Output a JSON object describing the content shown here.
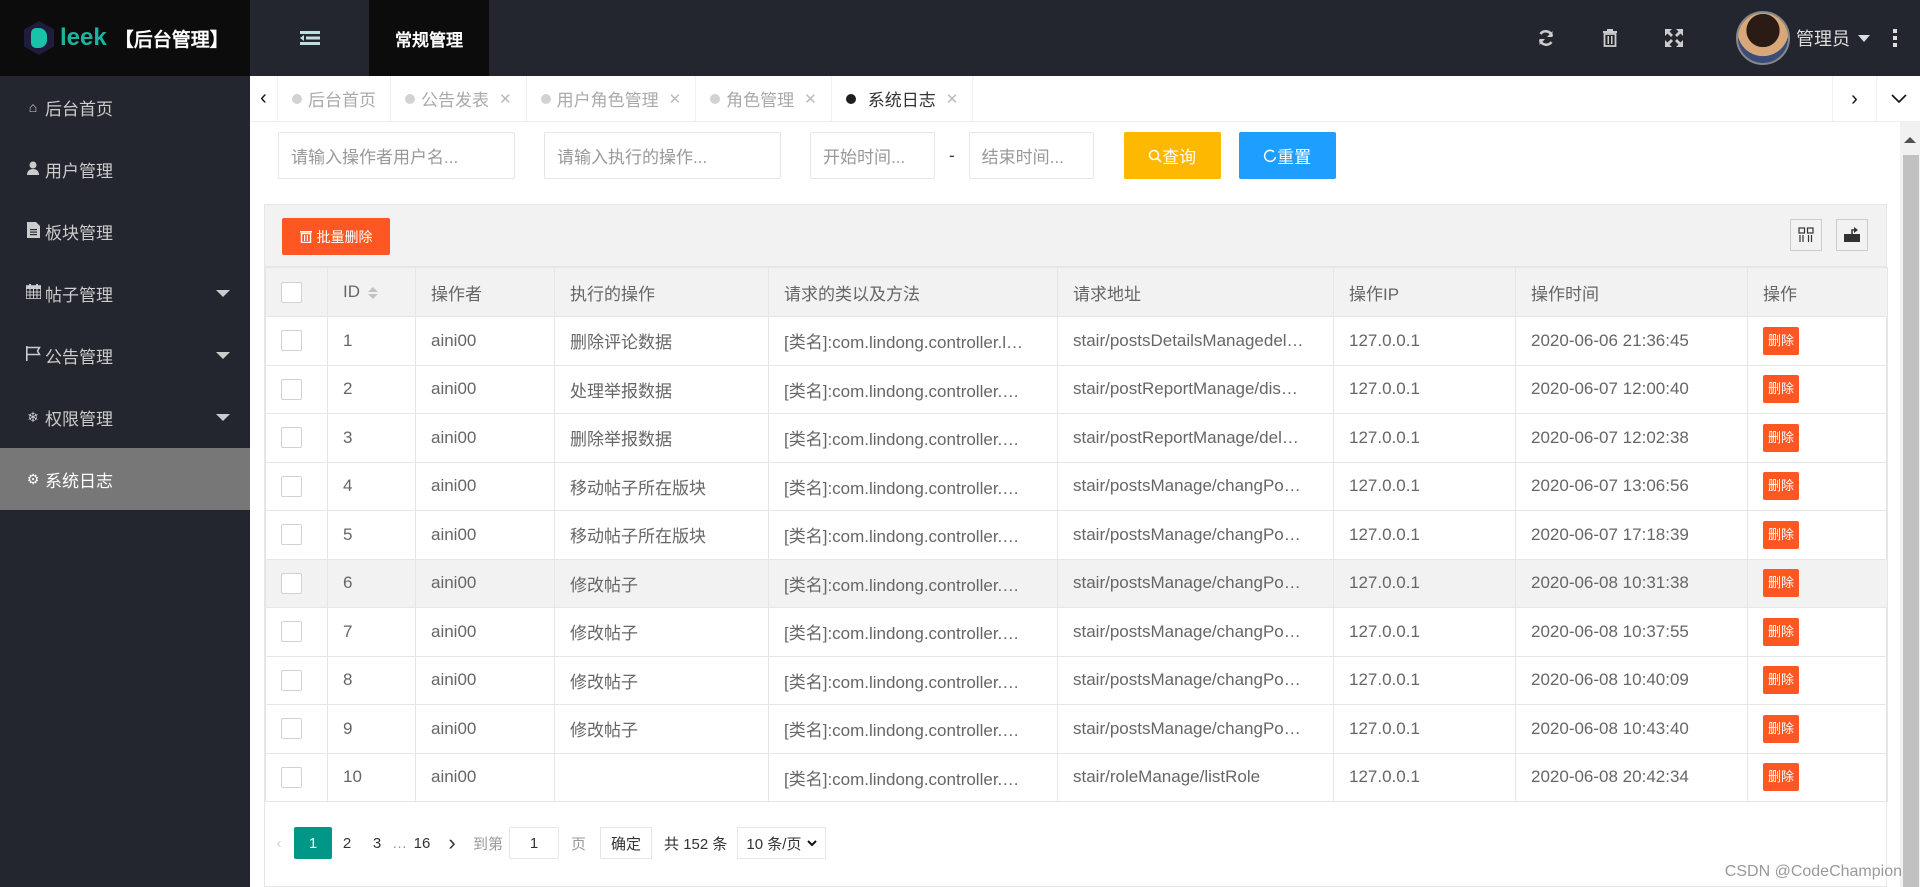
{
  "header": {
    "logo_text": "leek",
    "app_title": "【后台管理】",
    "fold_icon": "menu-fold-icon",
    "nav_main": "常规管理",
    "icons": [
      "refresh-icon",
      "trash-icon",
      "fullscreen-icon"
    ],
    "user_name": "管理员"
  },
  "sidebar": {
    "items": [
      {
        "label": "后台首页",
        "icon": "home-icon",
        "glyph": "⌂",
        "has_dropdown": false
      },
      {
        "label": "用户管理",
        "icon": "user-icon",
        "glyph": "👤",
        "has_dropdown": false
      },
      {
        "label": "板块管理",
        "icon": "file-icon",
        "glyph": "▤",
        "has_dropdown": false
      },
      {
        "label": "帖子管理",
        "icon": "calendar-icon",
        "glyph": "▦",
        "has_dropdown": true
      },
      {
        "label": "公告管理",
        "icon": "flag-icon",
        "glyph": "⚐",
        "has_dropdown": true
      },
      {
        "label": "权限管理",
        "icon": "snowflake-icon",
        "glyph": "❄",
        "has_dropdown": true
      },
      {
        "label": "系统日志",
        "icon": "cogs-icon",
        "glyph": "⚙",
        "has_dropdown": false,
        "active": true
      }
    ]
  },
  "tabs": [
    {
      "label": "后台首页",
      "closable": false,
      "active": false
    },
    {
      "label": "公告发表",
      "closable": true,
      "active": false
    },
    {
      "label": "用户角色管理",
      "closable": true,
      "active": false
    },
    {
      "label": "角色管理",
      "closable": true,
      "active": false
    },
    {
      "label": "系统日志",
      "closable": true,
      "active": true
    }
  ],
  "search": {
    "operator_placeholder": "请输入操作者用户名...",
    "operation_placeholder": "请输入执行的操作...",
    "start_placeholder": "开始时间...",
    "separator": "-",
    "end_placeholder": "结束时间...",
    "query_label": "查询",
    "reset_label": "重置",
    "query_color": "#ffb800",
    "reset_color": "#1e9fff"
  },
  "toolbar": {
    "batch_delete_label": "批量删除"
  },
  "table": {
    "columns": [
      "ID",
      "操作者",
      "执行的操作",
      "请求的类以及方法",
      "请求地址",
      "操作IP",
      "操作时间",
      "操作"
    ],
    "delete_label": "删除",
    "rows": [
      {
        "id": "1",
        "operator": "aini00",
        "operation": "删除评论数据",
        "method": "[类名]:com.lindong.controller.l…",
        "url": "stair/postsDetailsManagedel…",
        "ip": "127.0.0.1",
        "time": "2020-06-06 21:36:45"
      },
      {
        "id": "2",
        "operator": "aini00",
        "operation": "处理举报数据",
        "method": "[类名]:com.lindong.controller.…",
        "url": "stair/postReportManage/dis…",
        "ip": "127.0.0.1",
        "time": "2020-06-07 12:00:40"
      },
      {
        "id": "3",
        "operator": "aini00",
        "operation": "删除举报数据",
        "method": "[类名]:com.lindong.controller.…",
        "url": "stair/postReportManage/del…",
        "ip": "127.0.0.1",
        "time": "2020-06-07 12:02:38"
      },
      {
        "id": "4",
        "operator": "aini00",
        "operation": "移动帖子所在版块",
        "method": "[类名]:com.lindong.controller.…",
        "url": "stair/postsManage/changPo…",
        "ip": "127.0.0.1",
        "time": "2020-06-07 13:06:56"
      },
      {
        "id": "5",
        "operator": "aini00",
        "operation": "移动帖子所在版块",
        "method": "[类名]:com.lindong.controller.…",
        "url": "stair/postsManage/changPo…",
        "ip": "127.0.0.1",
        "time": "2020-06-07 17:18:39"
      },
      {
        "id": "6",
        "operator": "aini00",
        "operation": "修改帖子",
        "method": "[类名]:com.lindong.controller.…",
        "url": "stair/postsManage/changPo…",
        "ip": "127.0.0.1",
        "time": "2020-06-08 10:31:38",
        "highlight": true
      },
      {
        "id": "7",
        "operator": "aini00",
        "operation": "修改帖子",
        "method": "[类名]:com.lindong.controller.…",
        "url": "stair/postsManage/changPo…",
        "ip": "127.0.0.1",
        "time": "2020-06-08 10:37:55"
      },
      {
        "id": "8",
        "operator": "aini00",
        "operation": "修改帖子",
        "method": "[类名]:com.lindong.controller.…",
        "url": "stair/postsManage/changPo…",
        "ip": "127.0.0.1",
        "time": "2020-06-08 10:40:09"
      },
      {
        "id": "9",
        "operator": "aini00",
        "operation": "修改帖子",
        "method": "[类名]:com.lindong.controller.…",
        "url": "stair/postsManage/changPo…",
        "ip": "127.0.0.1",
        "time": "2020-06-08 10:43:40"
      },
      {
        "id": "10",
        "operator": "aini00",
        "operation": "",
        "method": "[类名]:com.lindong.controller.…",
        "url": "stair/roleManage/listRole",
        "ip": "127.0.0.1",
        "time": "2020-06-08 20:42:34"
      }
    ]
  },
  "pagination": {
    "pages": [
      "1",
      "2",
      "3"
    ],
    "ellipsis": "…",
    "last_page": "16",
    "current": "1",
    "goto_label": "到第",
    "goto_value": "1",
    "page_unit": "页",
    "confirm_label": "确定",
    "total_label": "共 152 条",
    "page_size": "10 条/页"
  },
  "watermark": "CSDN @CodeChampion"
}
